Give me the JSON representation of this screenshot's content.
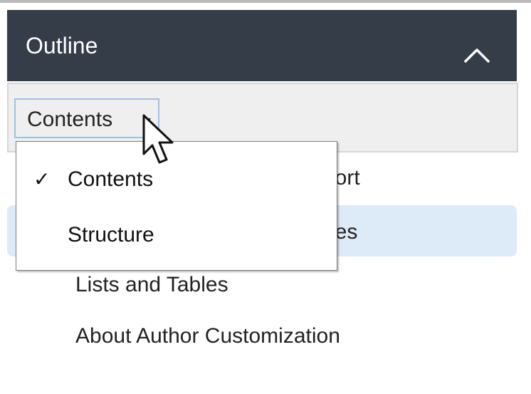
{
  "outline": {
    "title": "Outline",
    "collapse_icon": "chevron-up-icon"
  },
  "toolbar": {
    "view_select_value": "Contents",
    "caret_icon": "caret-down-icon"
  },
  "dropdown": {
    "items": [
      {
        "label": "Contents",
        "checked": true,
        "check_mark": "✓"
      },
      {
        "label": "Structure",
        "checked": false
      }
    ]
  },
  "list": {
    "items": [
      {
        "visible_text": "port"
      },
      {
        "visible_text": "ges"
      },
      {
        "label": "Lists and Tables"
      },
      {
        "label": "About Author Customization"
      }
    ]
  },
  "colors": {
    "header_bg": "#353d49",
    "header_text": "#ffffff",
    "toolbar_bg": "#efefef",
    "select_border": "#9fc1e4",
    "selected_row_bg": "#ddeaf7"
  },
  "cursor": {
    "icon": "mouse-pointer-icon"
  }
}
